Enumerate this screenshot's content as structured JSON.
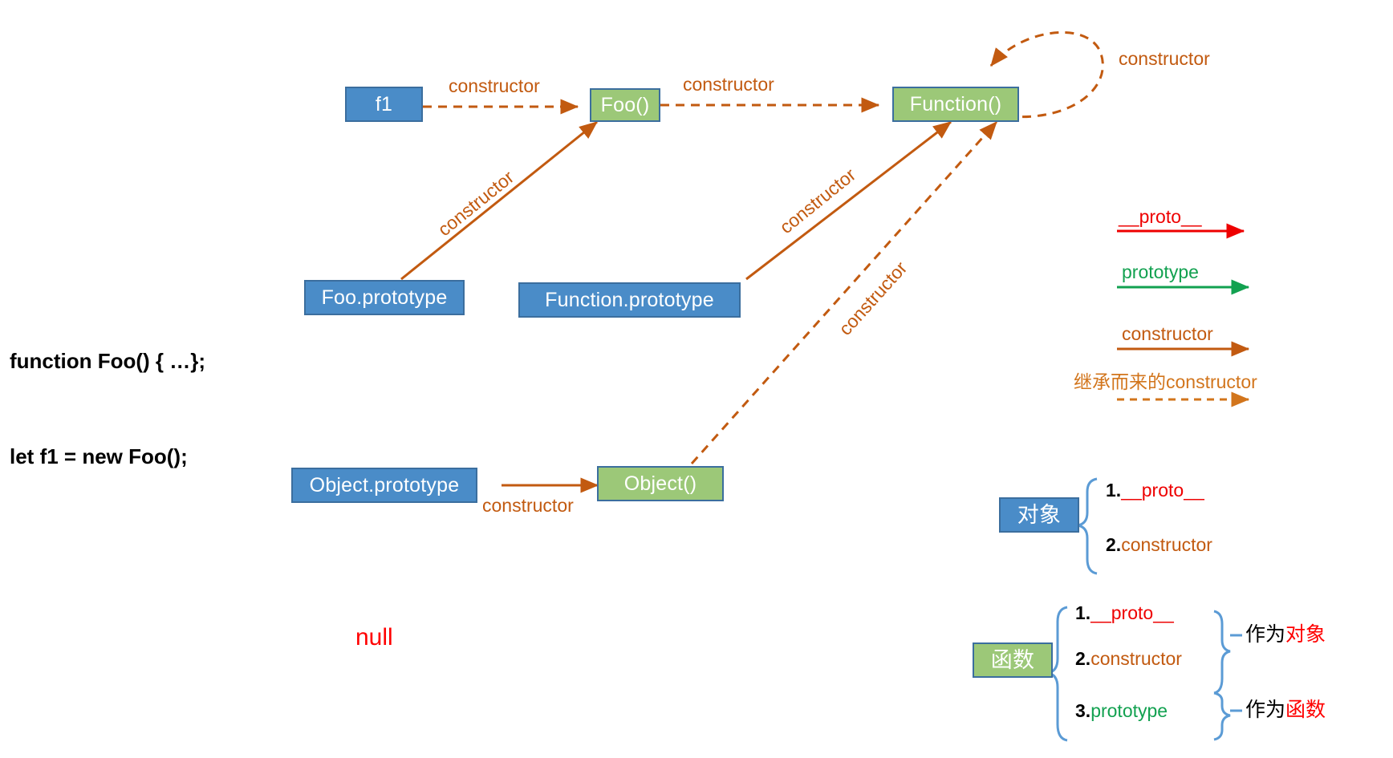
{
  "code": {
    "line1": "function Foo() { …};",
    "line2": "let f1 = new Foo();"
  },
  "nodes": {
    "f1": "f1",
    "foo": "Foo()",
    "function": "Function()",
    "foo_prototype": "Foo.prototype",
    "function_prototype": "Function.prototype",
    "object_prototype": "Object.prototype",
    "object": "Object()",
    "object_cjk": "对象",
    "function_cjk": "函数"
  },
  "edges": {
    "f1_to_foo": "constructor",
    "foo_to_function": "constructor",
    "function_self": "constructor",
    "fooproto_to_foo": "constructor",
    "funcproto_to_function": "constructor",
    "object_to_function": "constructor",
    "objproto_to_object": "constructor"
  },
  "null_text": "null",
  "legend": [
    {
      "label": "__proto__",
      "color": "#EE0000",
      "style": "solid"
    },
    {
      "label": "prototype",
      "color": "#12A150",
      "style": "solid"
    },
    {
      "label": "constructor",
      "color": "#C25A10",
      "style": "solid"
    },
    {
      "label": "继承而来的constructor",
      "color": "#D2751C",
      "style": "dashed"
    }
  ],
  "object_group": {
    "title": "对象",
    "items": [
      {
        "num": "1.",
        "label": "__proto__",
        "color": "#EE0000"
      },
      {
        "num": "2.",
        "label": "constructor",
        "color": "#C25A10"
      }
    ]
  },
  "function_group": {
    "title": "函数",
    "items": [
      {
        "num": "1.",
        "label": "__proto__",
        "color": "#EE0000"
      },
      {
        "num": "2.",
        "label": "constructor",
        "color": "#C25A10"
      },
      {
        "num": "3.",
        "label": "prototype",
        "color": "#12A150"
      }
    ],
    "notes": [
      {
        "prefix": "作为",
        "highlight": "对象"
      },
      {
        "prefix": "作为",
        "highlight": "函数"
      }
    ]
  },
  "colors": {
    "box_blue": "#4A8CC8",
    "box_green": "#9CC878",
    "box_border": "#3B6E9E",
    "arrow_orange": "#C25A10",
    "proto_red": "#EE0000",
    "prototype_green": "#12A150",
    "brace_blue": "#5B9BD5"
  }
}
